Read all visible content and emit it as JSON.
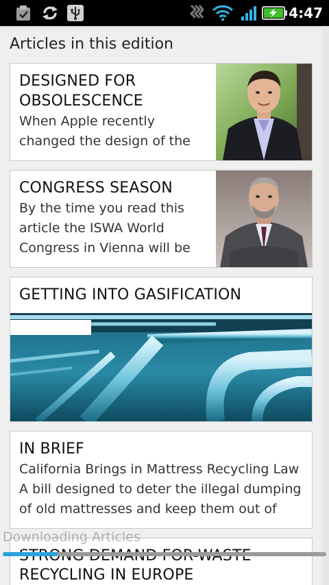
{
  "status_bar": {
    "time": "4:47",
    "icons": [
      "clipboard-check-icon",
      "sync-icon",
      "usb-icon",
      "signal-strip-icon",
      "wifi-icon",
      "cell-signal-icon",
      "battery-charging-icon"
    ],
    "battery_color": "#3fbf2a",
    "signal_color": "#33b5e5"
  },
  "section_title": "Articles in this edition",
  "articles": [
    {
      "title_lines": [
        "DESIGNED FOR",
        "OBSOLESCENCE"
      ],
      "summary_lines": [
        "When Apple recently",
        "changed the design of the"
      ]
    },
    {
      "title_lines": [
        "CONGRESS SEASON"
      ],
      "summary_lines": [
        "By the time you read this",
        "article the ISWA World",
        "Congress in Vienna will be"
      ]
    },
    {
      "title_lines": [
        "GETTING INTO GASIFICATION"
      ]
    },
    {
      "title_lines": [
        "IN BRIEF"
      ],
      "summary_lines": [
        "California Brings in Mattress Recycling Law",
        "A bill designed to deter the illegal dumping",
        "of old mattresses and keep them out of"
      ]
    },
    {
      "title_lines": [
        "STRONG DEMAND FOR-WASTE",
        "RECYCLING IN EUROPE"
      ]
    }
  ],
  "download": {
    "label": "Downloading Articles",
    "progress_percent": 17,
    "accent": "#2aa3dc"
  }
}
